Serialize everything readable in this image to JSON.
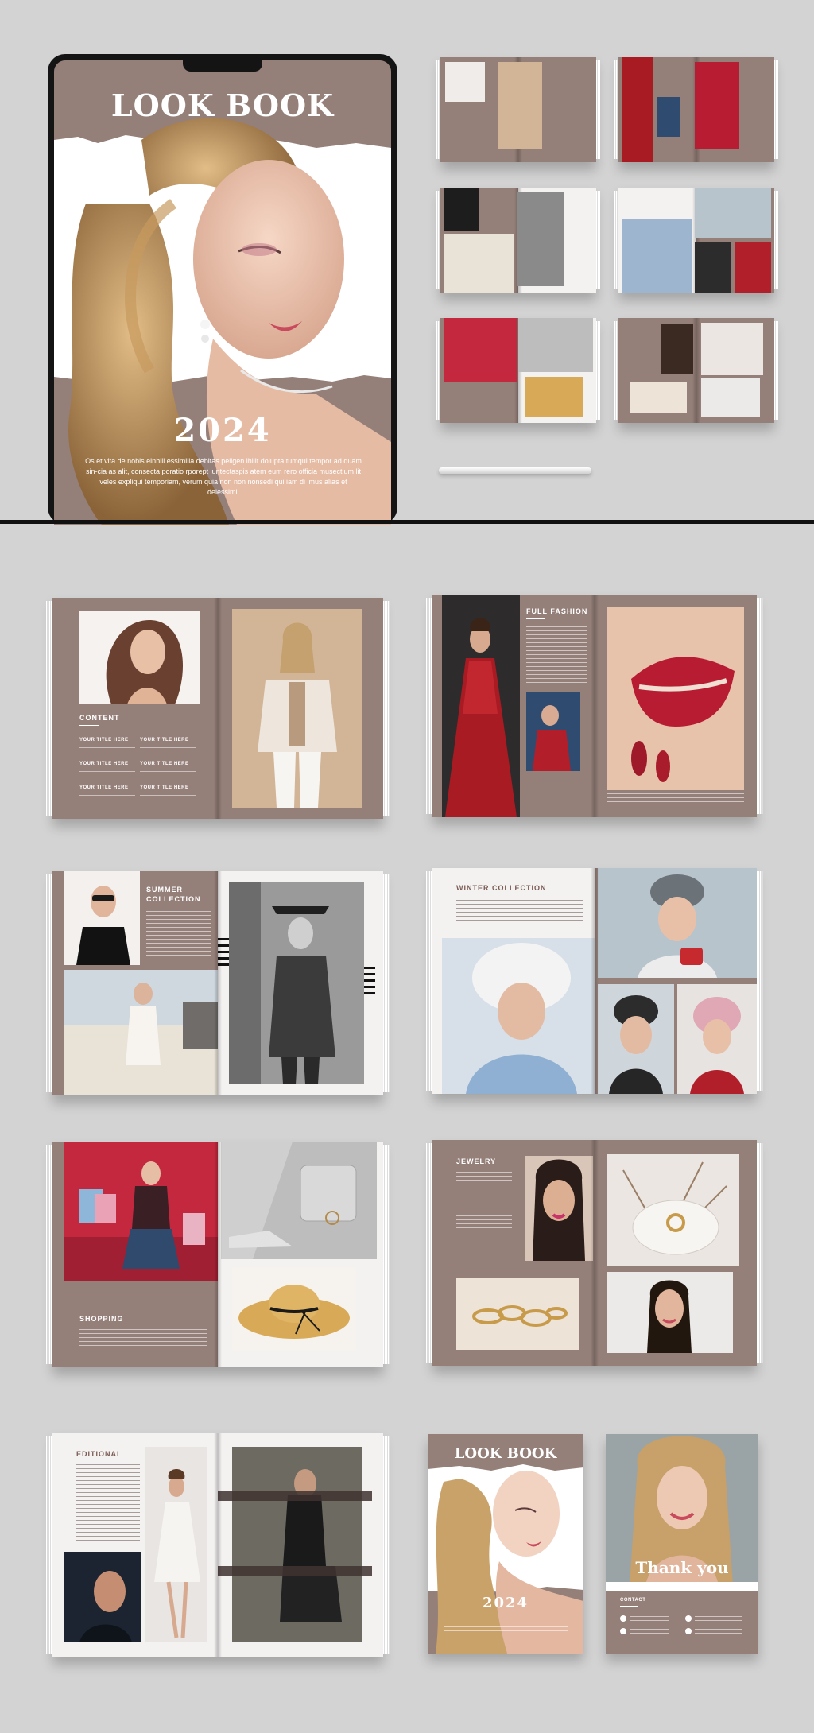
{
  "cover": {
    "title": "LOOK BOOK",
    "year": "2024",
    "body": "Os et vita de nobis einhill essimilla debitas peligen ihilit dolupta tumqui tempor ad quam sin-cia as alit, consecta poratio rporept iuntectaspis atem eum rero officia musectium lit veles expliqui temporiam, verum quia non non nonsedi qui iam di imus alias et delessimi."
  },
  "spreads": {
    "content": {
      "heading": "CONTENT",
      "items": [
        "YOUR TITLE HERE",
        "YOUR TITLE HERE",
        "YOUR TITLE HERE",
        "YOUR TITLE HERE",
        "YOUR TITLE HERE",
        "YOUR TITLE HERE"
      ]
    },
    "full_fashion": {
      "heading": "FULL FASHION"
    },
    "summer": {
      "heading_line1": "SUMMER",
      "heading_line2": "COLLECTION"
    },
    "winter": {
      "heading": "WINTER COLLECTION"
    },
    "shopping": {
      "heading": "SHOPPING"
    },
    "jewelry": {
      "heading": "JEWELRY"
    },
    "editional": {
      "heading": "EDITIONAL"
    }
  },
  "back_cover": {
    "thank_you": "Thank you",
    "contact_heading": "CONTACT"
  },
  "colors": {
    "taupe": "#957f79",
    "background": "#d3d3d3",
    "accent_red": "#b01e2a"
  }
}
